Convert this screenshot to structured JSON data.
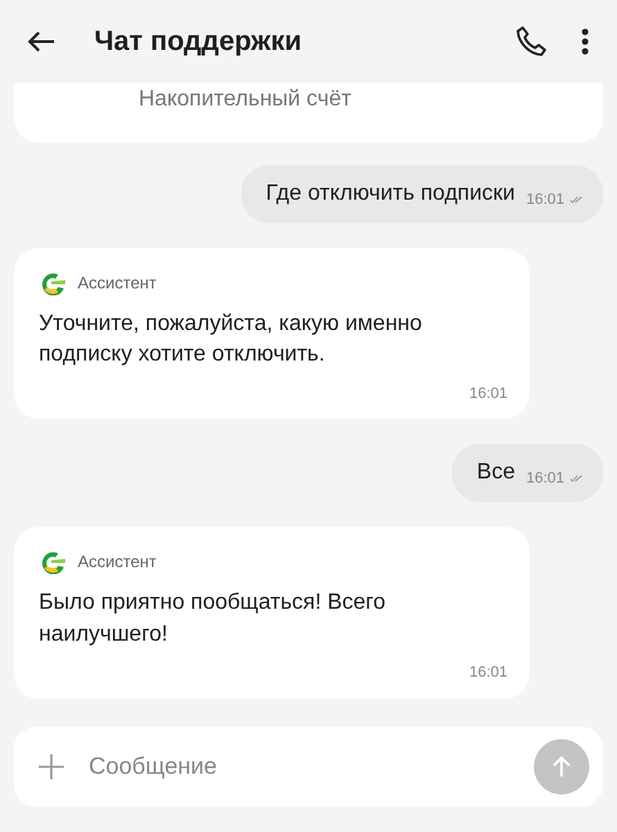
{
  "header": {
    "title": "Чат поддержки"
  },
  "partial_card": {
    "label": "Накопительный счёт"
  },
  "messages": [
    {
      "kind": "outgoing",
      "text": "Где отключить подписки",
      "time": "16:01"
    },
    {
      "kind": "incoming",
      "sender": "Ассистент",
      "text": "Уточните, пожалуйста, какую именно подписку хотите отключить.",
      "time": "16:01"
    },
    {
      "kind": "outgoing",
      "text": "Все",
      "time": "16:01"
    },
    {
      "kind": "incoming",
      "sender": "Ассистент",
      "text": "Было приятно пообщаться! Всего наилучшего!",
      "time": "16:01"
    }
  ],
  "composer": {
    "placeholder": "Сообщение",
    "send_disabled": true
  }
}
